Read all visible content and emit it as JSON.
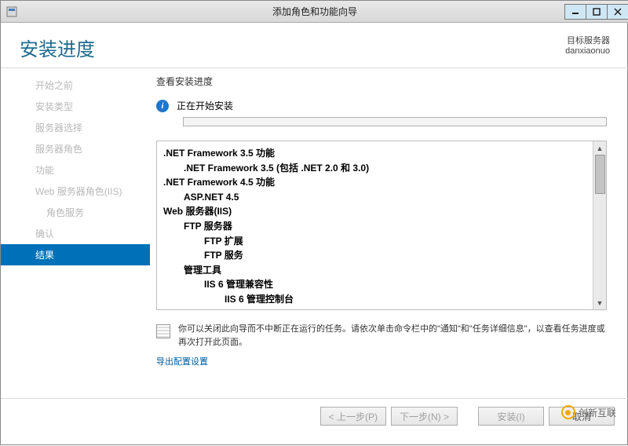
{
  "window": {
    "title": "添加角色和功能向导"
  },
  "header": {
    "page_title": "安装进度",
    "target_label": "目标服务器",
    "target_value": "danxiaonuo"
  },
  "sidebar": {
    "items": [
      {
        "label": "开始之前"
      },
      {
        "label": "安装类型"
      },
      {
        "label": "服务器选择"
      },
      {
        "label": "服务器角色"
      },
      {
        "label": "功能"
      },
      {
        "label": "Web 服务器角色(IIS)"
      },
      {
        "label": "角色服务",
        "sub": true
      },
      {
        "label": "确认"
      },
      {
        "label": "结果",
        "active": true
      }
    ]
  },
  "content": {
    "heading": "查看安装进度",
    "status": "正在开始安装",
    "features": [
      {
        "level": 0,
        "text": ".NET Framework 3.5 功能"
      },
      {
        "level": 1,
        "text": ".NET Framework 3.5 (包括 .NET 2.0 和 3.0)"
      },
      {
        "level": 0,
        "text": ".NET Framework 4.5 功能"
      },
      {
        "level": 1,
        "text": "ASP.NET 4.5"
      },
      {
        "level": 0,
        "text": "Web 服务器(IIS)"
      },
      {
        "level": 1,
        "text": "FTP 服务器"
      },
      {
        "level": 2,
        "text": "FTP 扩展"
      },
      {
        "level": 2,
        "text": "FTP 服务"
      },
      {
        "level": 1,
        "text": "管理工具"
      },
      {
        "level": 2,
        "text": "IIS 6 管理兼容性"
      },
      {
        "level": 3,
        "text": "IIS 6 管理控制台"
      }
    ],
    "note": "你可以关闭此向导而不中断正在运行的任务。请依次单击命令栏中的\"通知\"和\"任务详细信息\"，以查看任务进度或再次打开此页面。",
    "export_link": "导出配置设置"
  },
  "footer": {
    "prev": "< 上一步(P)",
    "next": "下一步(N) >",
    "install": "安装(I)",
    "cancel": "取消"
  },
  "watermark": "创新互联"
}
